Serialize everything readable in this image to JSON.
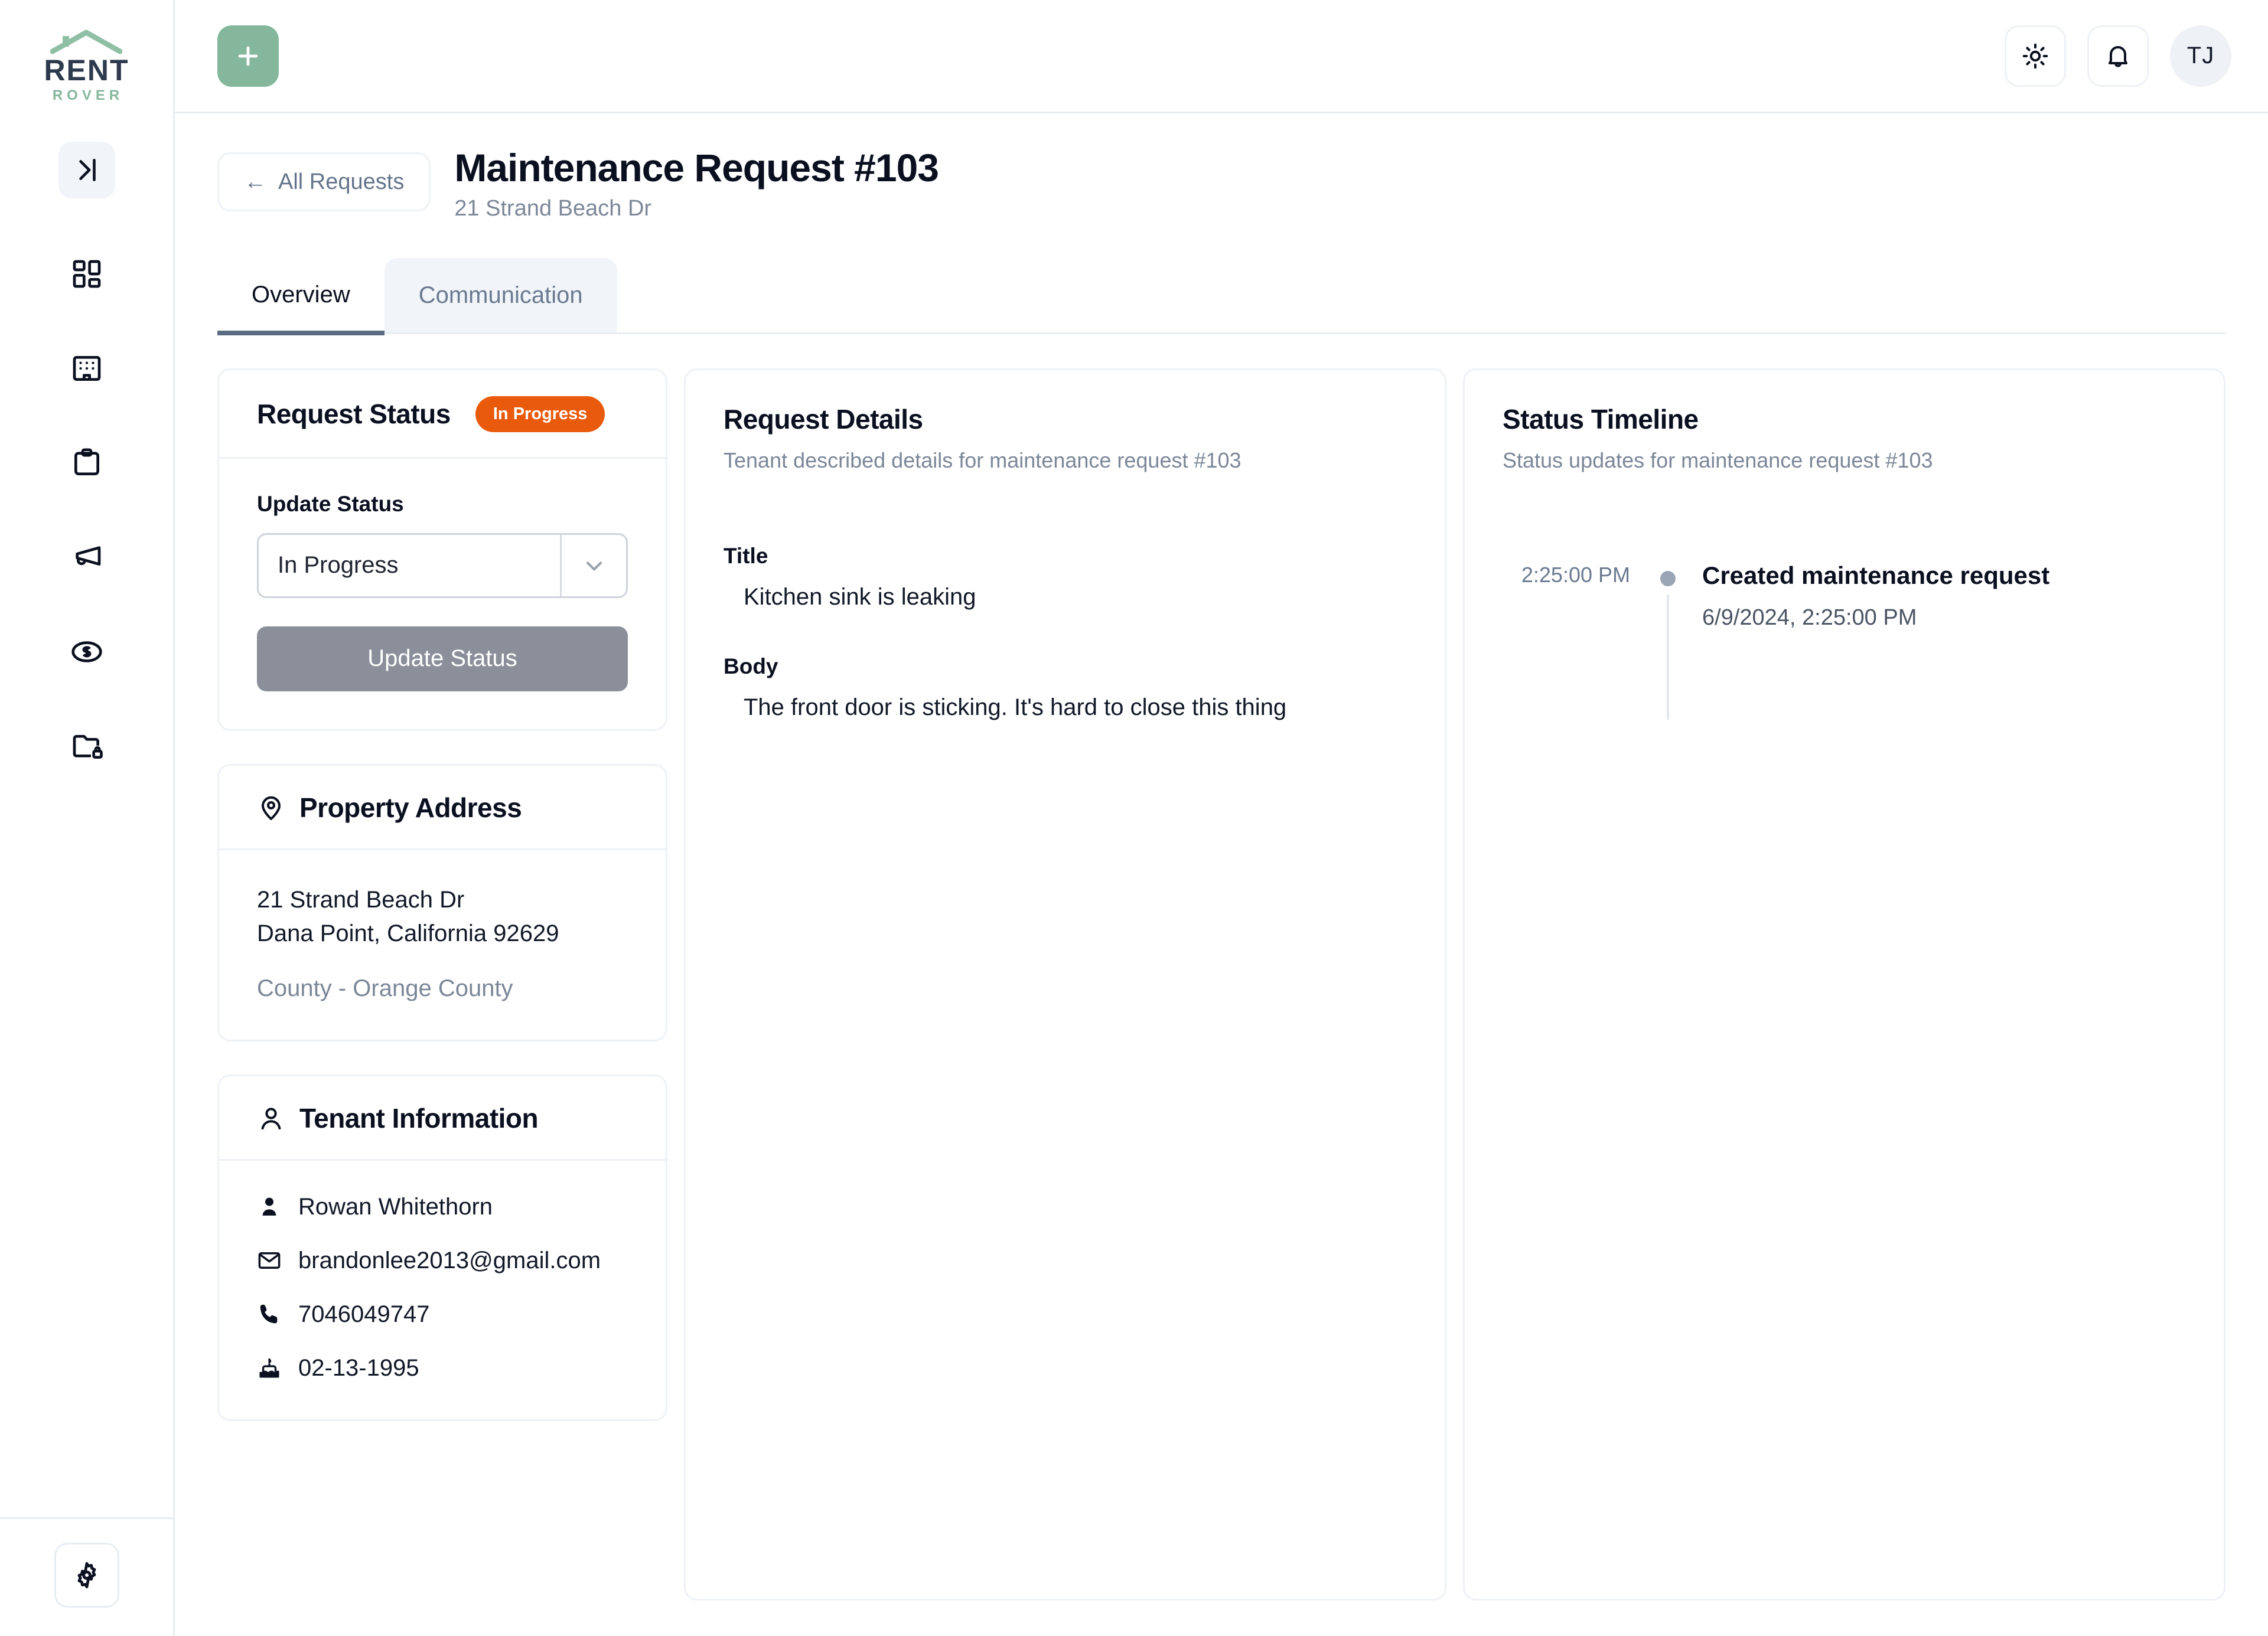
{
  "brand": {
    "name_top": "RENT",
    "name_bottom": "ROVER"
  },
  "sidebar": {
    "collapse_label": "collapse-sidebar",
    "items": [
      {
        "icon": "dashboard-grid-icon",
        "name": "dashboard"
      },
      {
        "icon": "building-icon",
        "name": "properties"
      },
      {
        "icon": "clipboard-icon",
        "name": "requests"
      },
      {
        "icon": "megaphone-icon",
        "name": "announcements"
      },
      {
        "icon": "dollar-coin-icon",
        "name": "payments"
      },
      {
        "icon": "locked-folder-icon",
        "name": "documents"
      }
    ],
    "settings_icon": "gear-icon"
  },
  "topbar": {
    "add_icon": "plus-icon",
    "theme_icon": "sun-icon",
    "notifications_icon": "bell-icon",
    "avatar_initials": "TJ"
  },
  "header": {
    "back_label": "All Requests",
    "back_arrow": "←",
    "title": "Maintenance Request #103",
    "subtitle": "21 Strand Beach Dr"
  },
  "tabs": [
    {
      "label": "Overview",
      "active": true
    },
    {
      "label": "Communication",
      "active": false
    }
  ],
  "request_status": {
    "title": "Request Status",
    "badge": "In Progress",
    "badge_color": "#ea5a0c",
    "update_label": "Update Status",
    "select_value": "In Progress",
    "select_options": [
      "In Progress"
    ],
    "button_label": "Update Status"
  },
  "property_address": {
    "title": "Property Address",
    "icon": "map-pin-icon",
    "line1": "21 Strand Beach Dr",
    "line2": "Dana Point, California 92629",
    "county": "County - Orange County"
  },
  "tenant_information": {
    "title": "Tenant Information",
    "icon": "user-outline-icon",
    "rows": [
      {
        "icon": "person-icon",
        "value": "Rowan Whitethorn"
      },
      {
        "icon": "envelope-icon",
        "value": "brandonlee2013@gmail.com"
      },
      {
        "icon": "phone-icon",
        "value": "7046049747"
      },
      {
        "icon": "birthday-cake-icon",
        "value": "02-13-1995"
      }
    ]
  },
  "request_details": {
    "title": "Request Details",
    "subtitle": "Tenant described details for maintenance request #103",
    "title_label": "Title",
    "title_value": "Kitchen sink is leaking",
    "body_label": "Body",
    "body_value": "The front door is sticking. It's hard to close this thing"
  },
  "status_timeline": {
    "title": "Status Timeline",
    "subtitle": "Status updates for maintenance request #103",
    "events": [
      {
        "time": "2:25:00 PM",
        "title": "Created maintenance request",
        "timestamp": "6/9/2024, 2:25:00 PM"
      }
    ]
  }
}
